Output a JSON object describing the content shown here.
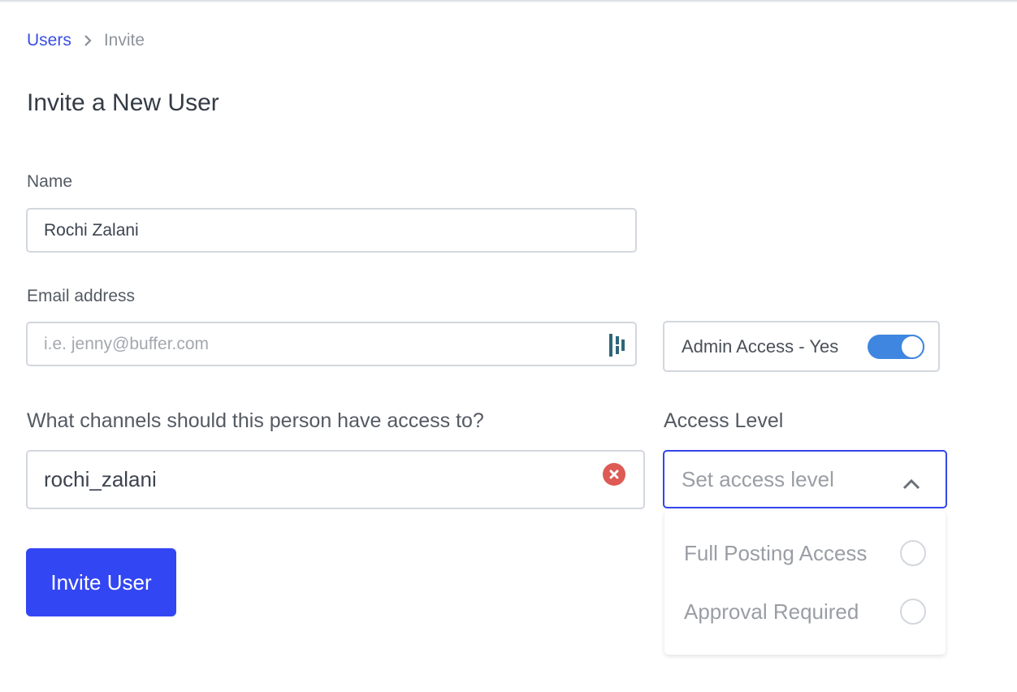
{
  "breadcrumb": {
    "parent": "Users",
    "current": "Invite"
  },
  "page": {
    "title": "Invite a New User"
  },
  "form": {
    "name_label": "Name",
    "name_value": "Rochi Zalani",
    "email_label": "Email address",
    "email_placeholder": "i.e. jenny@buffer.com",
    "email_value": "",
    "admin_access_label": "Admin Access - Yes",
    "admin_access_enabled": true,
    "channels_label": "What channels should this person have access to?",
    "channels_value": "rochi_zalani",
    "access_level_label": "Access Level",
    "access_level_placeholder": "Set access level",
    "access_level_options": [
      {
        "label": "Full Posting Access",
        "selected": false
      },
      {
        "label": "Approval Required",
        "selected": false
      }
    ],
    "submit_label": "Invite User"
  },
  "icons": {
    "breadcrumb_separator": "chevron-right-icon",
    "email_autofill": "password-manager-icon",
    "channel_clear": "clear-x-icon",
    "dropdown_toggle": "chevron-up-icon"
  },
  "colors": {
    "accent": "#3346f3",
    "link": "#3a4fe0",
    "toggle_on": "#3f86e0",
    "clear": "#dd5a55"
  }
}
